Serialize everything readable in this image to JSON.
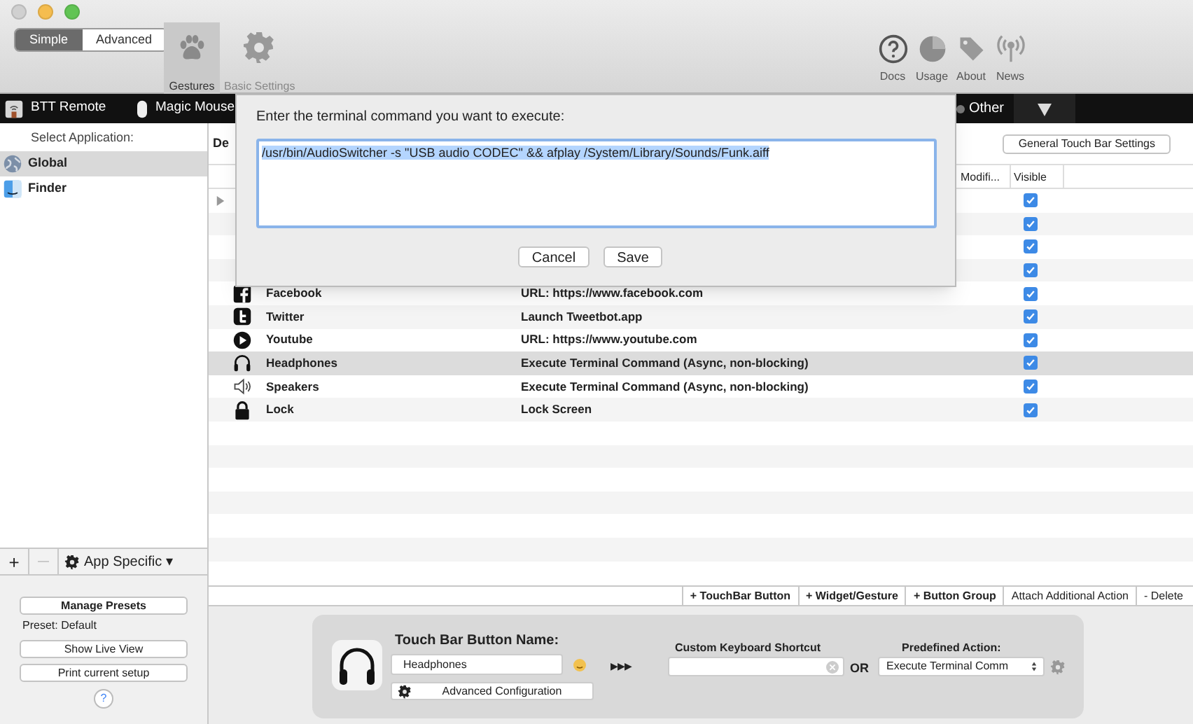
{
  "window": {
    "mode_switch": [
      {
        "label": "Simple",
        "selected": true
      },
      {
        "label": "Advanced",
        "selected": false
      }
    ],
    "toolbar_tabs": [
      {
        "label": "Gestures",
        "kind": "paw",
        "selected": true
      },
      {
        "label": "Basic Settings",
        "kind": "gear",
        "selected": false
      }
    ],
    "toolbar_links": [
      {
        "label": "Docs",
        "kind": "help"
      },
      {
        "label": "Usage",
        "kind": "pie"
      },
      {
        "label": "About",
        "kind": "tags"
      },
      {
        "label": "News",
        "kind": "antenna"
      }
    ]
  },
  "device_bar": {
    "devices": [
      {
        "label": "BTT Remote",
        "kind": "remote"
      },
      {
        "label": "Magic Mouse",
        "kind": "mouse"
      }
    ],
    "other": "Other"
  },
  "sidebar": {
    "header": "Select Application:",
    "apps": [
      {
        "label": "Global",
        "kind": "globe",
        "selected": true
      },
      {
        "label": "Finder",
        "kind": "finder",
        "selected": false
      }
    ],
    "add": "+",
    "remove": "—",
    "scope": "App Specific ▾",
    "manage_presets": "Manage Presets",
    "preset": "Preset: Default",
    "show_live_view": "Show Live View",
    "print_setup": "Print current setup",
    "help": "?"
  },
  "table": {
    "section_header": "De",
    "settings_button": "General Touch Bar Settings",
    "columns": [
      "Modifi...",
      "Visible"
    ],
    "rows": [
      {
        "kind": "group",
        "expanded": false,
        "visible": true,
        "selected": false
      },
      {
        "kind": "covered",
        "visible": true,
        "selected": false
      },
      {
        "kind": "covered",
        "visible": true,
        "selected": false
      },
      {
        "kind": "covered",
        "visible": true,
        "selected": false
      },
      {
        "kind": "action",
        "name": "Facebook",
        "action": "URL: https://www.facebook.com",
        "visible": true,
        "selected": false
      },
      {
        "kind": "action",
        "name": "Twitter",
        "action": "Launch Tweetbot.app",
        "visible": true,
        "selected": false
      },
      {
        "kind": "action",
        "name": "Youtube",
        "action": "URL: https://www.youtube.com",
        "visible": true,
        "selected": false
      },
      {
        "kind": "action",
        "name": "Headphones",
        "action": "Execute Terminal Command (Async, non-blocking)",
        "visible": true,
        "selected": true
      },
      {
        "kind": "action",
        "name": "Speakers",
        "action": "Execute Terminal Command (Async, non-blocking)",
        "visible": true,
        "selected": false
      },
      {
        "kind": "action",
        "name": "Lock",
        "action": "Lock Screen",
        "visible": true,
        "selected": false
      }
    ],
    "actions": [
      "+ TouchBar Button",
      "+ Widget/Gesture",
      "+ Button Group",
      "Attach Additional Action",
      "- Delete"
    ]
  },
  "editor": {
    "name_label": "Touch Bar Button Name:",
    "name_value": "Headphones",
    "advanced": "Advanced Configuration",
    "arrows": "▶▶▶",
    "shortcut_label": "Custom Keyboard Shortcut",
    "or": "OR",
    "predefined_label": "Predefined Action:",
    "predefined_value": "Execute Terminal Comm"
  },
  "dialog": {
    "prompt": "Enter the terminal command you want to execute:",
    "command": "/usr/bin/AudioSwitcher -s \"USB audio CODEC\" && afplay /System/Library/Sounds/Funk.aiff",
    "cancel": "Cancel",
    "save": "Save"
  }
}
